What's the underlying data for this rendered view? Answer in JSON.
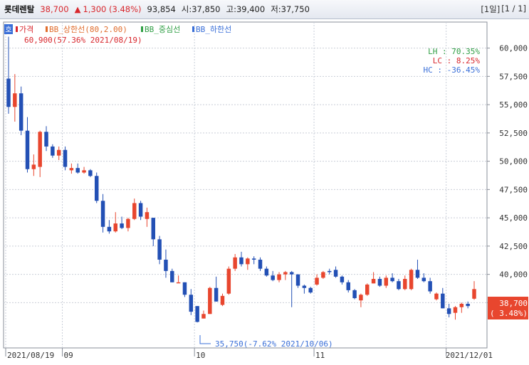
{
  "header": {
    "name": "롯데렌탈",
    "price": "38,700",
    "change_arrow": "▲",
    "change": "1,300 (3.48%)",
    "volume": "93,854",
    "open": "시:37,850",
    "high": "고:39,400",
    "low": "저:37,750",
    "page_period": "[1일]",
    "page_count": "[1 / 1]"
  },
  "legend": {
    "box_label": "호",
    "items": [
      {
        "name": "가격",
        "color": "#d8262c"
      },
      {
        "name": "BB_상한선(80,2.00)",
        "color": "#e06c2c"
      },
      {
        "name": "BB_중심선",
        "color": "#2f9e44"
      },
      {
        "name": "BB_하한선",
        "color": "#3a6fd8"
      }
    ],
    "max_note": "60,900(57.36% 2021/08/19)",
    "min_note": "35,750(-7.62% 2021/10/06)"
  },
  "stats": [
    {
      "label": "LH",
      "value": "70.35%",
      "color": "#2f9e44"
    },
    {
      "label": "LC",
      "value": "8.25%",
      "color": "#d8262c"
    },
    {
      "label": "HC",
      "value": "-36.45%",
      "color": "#3a6fd8"
    }
  ],
  "last_price_box": {
    "price": "38,700",
    "pct": "( 3.48%)"
  },
  "chart_data": {
    "type": "candlestick",
    "ylim": [
      33500,
      62300
    ],
    "yticks": [
      37500,
      40000,
      42500,
      45000,
      47500,
      50000,
      52500,
      55000,
      57500,
      60000
    ],
    "ytick_labels": [
      "37,500",
      "40,000",
      "42,500",
      "45,000",
      "47,500",
      "50,000",
      "52,500",
      "55,000",
      "57,500",
      "60,000"
    ],
    "xlabels": [
      {
        "label": "2021/08/19",
        "index": 0
      },
      {
        "label": "09",
        "index": 9
      },
      {
        "label": "10",
        "index": 30
      },
      {
        "label": "11",
        "index": 49
      },
      {
        "label": "2021/12/01",
        "index": 70
      }
    ],
    "candles": [
      [
        57300,
        61000,
        54200,
        54800
      ],
      [
        54800,
        57700,
        53500,
        56000
      ],
      [
        56000,
        56600,
        52300,
        52700
      ],
      [
        52700,
        53900,
        49000,
        49300
      ],
      [
        49300,
        50600,
        48700,
        49700
      ],
      [
        49500,
        52700,
        48600,
        52600
      ],
      [
        52600,
        53100,
        50900,
        51300
      ],
      [
        51300,
        51500,
        50300,
        50500
      ],
      [
        50500,
        51300,
        50100,
        51000
      ],
      [
        51000,
        51300,
        49200,
        49500
      ],
      [
        49200,
        49800,
        48900,
        49400
      ],
      [
        49400,
        49800,
        48900,
        49000
      ],
      [
        49000,
        49500,
        48900,
        49200
      ],
      [
        49200,
        49300,
        48600,
        48700
      ],
      [
        48700,
        49000,
        46300,
        46500
      ],
      [
        46500,
        47100,
        43700,
        44200
      ],
      [
        44200,
        44800,
        43600,
        43800
      ],
      [
        43800,
        45500,
        43700,
        44500
      ],
      [
        44500,
        45100,
        44000,
        44100
      ],
      [
        44100,
        45000,
        43800,
        44900
      ],
      [
        44900,
        46700,
        44800,
        46300
      ],
      [
        46300,
        46500,
        44800,
        45100
      ],
      [
        44900,
        45900,
        44200,
        45500
      ],
      [
        45000,
        45000,
        42500,
        43100
      ],
      [
        43100,
        43400,
        40900,
        41300
      ],
      [
        41300,
        42200,
        39700,
        40300
      ],
      [
        40300,
        40500,
        39300,
        39300
      ],
      [
        39300,
        39900,
        39300,
        39300
      ],
      [
        39300,
        39300,
        38000,
        38200
      ],
      [
        38200,
        38700,
        36400,
        36700
      ],
      [
        37200,
        37200,
        35750,
        35800
      ],
      [
        36100,
        36800,
        36100,
        36500
      ],
      [
        36500,
        38900,
        36500,
        38800
      ],
      [
        38800,
        39800,
        37600,
        37600
      ],
      [
        37300,
        38300,
        37200,
        38100
      ],
      [
        38300,
        40700,
        38200,
        40500
      ],
      [
        40500,
        41800,
        40300,
        41500
      ],
      [
        41500,
        42000,
        40700,
        40900
      ],
      [
        40900,
        41500,
        40400,
        41400
      ],
      [
        41400,
        41600,
        40900,
        41300
      ],
      [
        41300,
        41500,
        40300,
        40500
      ],
      [
        40500,
        40700,
        39800,
        39900
      ],
      [
        39900,
        40300,
        39400,
        39500
      ],
      [
        39500,
        40200,
        39300,
        40000
      ],
      [
        40000,
        40300,
        39500,
        40200
      ],
      [
        40200,
        40300,
        37100,
        40000
      ],
      [
        40000,
        40000,
        38800,
        39000
      ],
      [
        39000,
        39100,
        38300,
        38800
      ],
      [
        38800,
        38900,
        38300,
        38400
      ],
      [
        39100,
        40000,
        39000,
        39700
      ],
      [
        39700,
        40300,
        39600,
        40200
      ],
      [
        40300,
        40500,
        40000,
        40200
      ],
      [
        40400,
        40700,
        39700,
        39800
      ],
      [
        39800,
        39900,
        39100,
        39300
      ],
      [
        39300,
        39500,
        38400,
        38600
      ],
      [
        38600,
        38700,
        37800,
        37900
      ],
      [
        37700,
        38300,
        37100,
        38200
      ],
      [
        38200,
        39200,
        38100,
        39100
      ],
      [
        39200,
        40200,
        39200,
        39600
      ],
      [
        39600,
        39800,
        38900,
        39000
      ],
      [
        39000,
        39900,
        38800,
        39700
      ],
      [
        39700,
        40100,
        39300,
        39400
      ],
      [
        39400,
        39600,
        38600,
        38700
      ],
      [
        38700,
        39900,
        38600,
        39600
      ],
      [
        38700,
        40500,
        38600,
        40400
      ],
      [
        40400,
        41300,
        39600,
        39700
      ],
      [
        39700,
        40100,
        39300,
        39400
      ],
      [
        39400,
        39700,
        38300,
        38500
      ],
      [
        37800,
        38400,
        37700,
        38300
      ],
      [
        38300,
        38800,
        37000,
        37000
      ],
      [
        37000,
        37400,
        36200,
        36500
      ],
      [
        36600,
        37200,
        36000,
        37100
      ],
      [
        37100,
        37500,
        36600,
        37400
      ],
      [
        37400,
        37600,
        37000,
        37200
      ],
      [
        37850,
        39400,
        37750,
        38700
      ]
    ]
  }
}
